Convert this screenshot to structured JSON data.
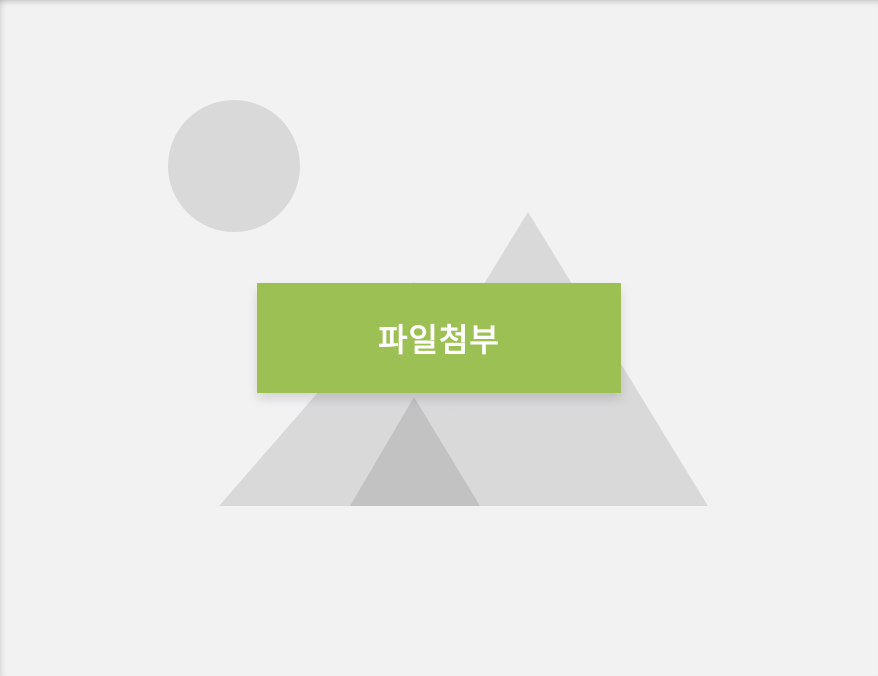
{
  "upload": {
    "button_label": "파일첨부",
    "button_color": "#9dc055",
    "placeholder_icon": "image-placeholder-icon",
    "background_color": "#f2f2f3",
    "shape_color_light": "#d9d9da",
    "shape_color_dark": "#c2c2c3"
  }
}
